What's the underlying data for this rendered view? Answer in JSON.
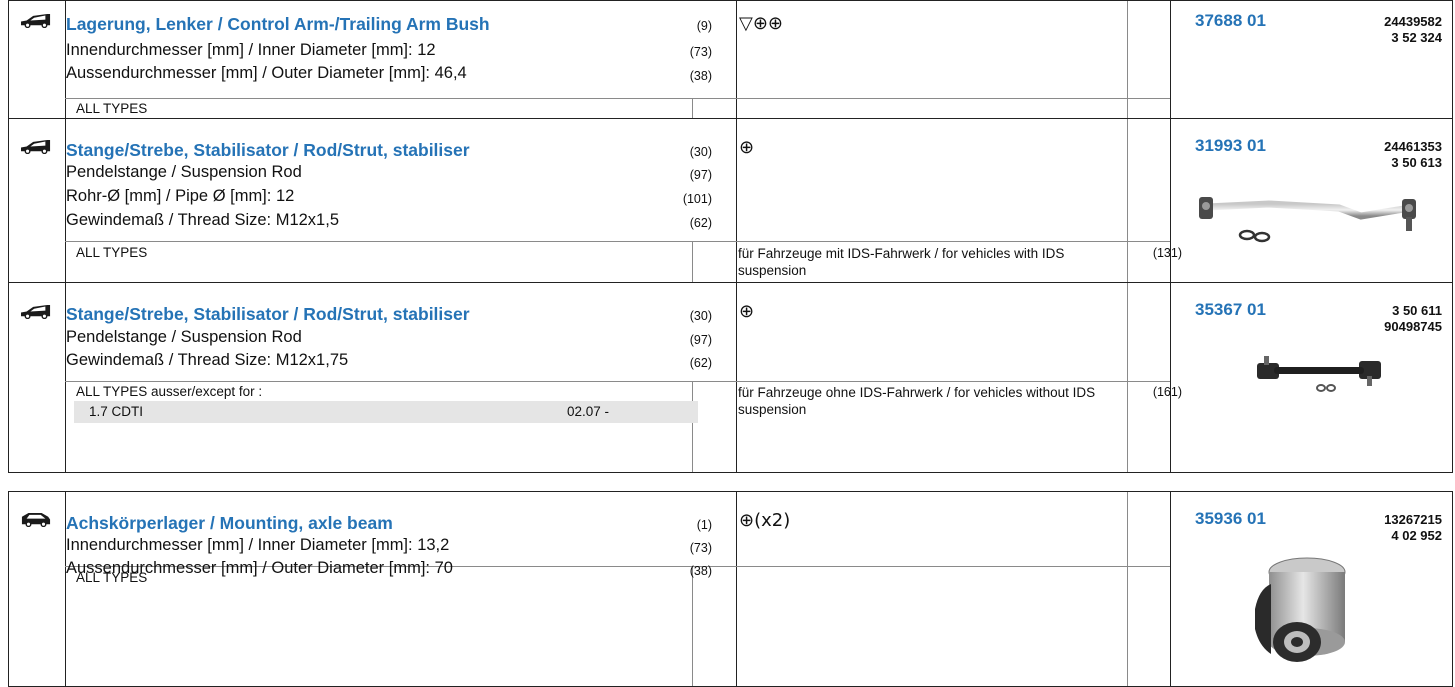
{
  "rows": [
    {
      "title": "Lagerung, Lenker / Control Arm-/Trailing Arm Bush",
      "title_ref": "(9)",
      "specs": [
        {
          "text": "Innendurchmesser [mm] / Inner Diameter [mm]: 12",
          "ref": "(73)"
        },
        {
          "text": "Aussendurchmesser [mm] / Outer Diameter [mm]: 46,4",
          "ref": "(38)"
        }
      ],
      "symbols": "▽⊕⊕",
      "types": "ALL TYPES",
      "part_number": "37688 01",
      "oe_numbers": [
        "24439582",
        "3 52 324"
      ]
    },
    {
      "title": "Stange/Strebe, Stabilisator / Rod/Strut, stabiliser",
      "title_ref": "(30)",
      "specs": [
        {
          "text": "Pendelstange / Suspension Rod",
          "ref": "(97)"
        },
        {
          "text": "Rohr-Ø [mm] / Pipe Ø [mm]: 12",
          "ref": "(101)"
        },
        {
          "text": "Gewindemaß / Thread Size: M12x1,5",
          "ref": "(62)"
        }
      ],
      "symbols": "⊕",
      "types": "ALL TYPES",
      "note": "für Fahrzeuge mit IDS-Fahrwerk / for vehicles with IDS suspension",
      "note_ref": "(131)",
      "part_number": "31993 01",
      "oe_numbers": [
        "24461353",
        "3 50 613"
      ]
    },
    {
      "title": "Stange/Strebe, Stabilisator / Rod/Strut, stabiliser",
      "title_ref": "(30)",
      "specs": [
        {
          "text": "Pendelstange / Suspension Rod",
          "ref": "(97)"
        },
        {
          "text": "Gewindemaß / Thread Size: M12x1,75",
          "ref": "(62)"
        }
      ],
      "symbols": "⊕",
      "types": "ALL TYPES ausser/except for :",
      "exception": {
        "engine": "1.7 CDTI",
        "date": "02.07  -"
      },
      "note": "für Fahrzeuge ohne IDS-Fahrwerk / for vehicles without IDS suspension",
      "note_ref": "(161)",
      "part_number": "35367 01",
      "oe_numbers": [
        "3 50 611",
        "90498745"
      ]
    },
    {
      "title": "Achskörperlager / Mounting, axle beam",
      "title_ref": "(1)",
      "specs": [
        {
          "text": "Innendurchmesser [mm] / Inner Diameter [mm]: 13,2",
          "ref": "(73)"
        },
        {
          "text": "Aussendurchmesser [mm] / Outer Diameter [mm]: 70",
          "ref": "(38)"
        }
      ],
      "symbols": "⊕(x2)",
      "types": "ALL TYPES",
      "part_number": "35936 01",
      "oe_numbers": [
        "13267215",
        "4 02 952"
      ]
    }
  ]
}
